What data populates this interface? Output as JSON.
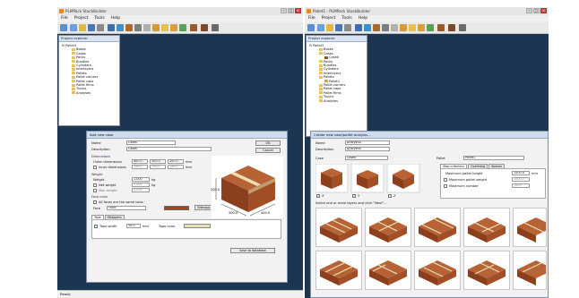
{
  "left_window": {
    "title": "PLMPack StackBuilder",
    "controls": [
      "–",
      "□",
      "×"
    ],
    "menu": [
      "File",
      "Project",
      "Tools",
      "Help"
    ],
    "explorer": {
      "title": "Project explorer",
      "root": "Pallet1",
      "items": [
        "Boxes",
        "Cases",
        "Packs",
        "Bundles",
        "Cylinders",
        "Interlayers",
        "Pallets",
        "Pallet corners",
        "Pallet caps",
        "Pallet films",
        "Trucks",
        "Analyses"
      ]
    },
    "dialog": {
      "title": "Add new case",
      "name_label": "Name",
      "name_value": "Case0",
      "desc_label": "Description",
      "desc_value": "Case0",
      "ok_label": "OK",
      "cancel_label": "Cancel",
      "dimensions_label": "Dimensions",
      "outer_label": "Outer dimensions",
      "outer_values": [
        "400.0",
        "300.0",
        "200.0"
      ],
      "inner_label": "Inner dimensions",
      "inner_values": [
        "396.0",
        "296.0",
        "196.0"
      ],
      "unit_mm": "mm",
      "weight_section": "Weight",
      "weight_label": "Weight",
      "weight_value": "1.000",
      "unit_kg": "kg",
      "net_weight_label": "Net weight",
      "net_weight_value": "0.000",
      "max_weight_label": "Max weight",
      "max_weight_value": "0.000",
      "face_color_section": "Face color",
      "all_faces_label": "All faces are the same color",
      "face_label": "Face",
      "face_value": "Front",
      "bitmaps_label": "Bitmaps...",
      "tabs": [
        "Tape",
        "Strappers"
      ],
      "tape_label": "Tape width",
      "tape_value": "50.0",
      "tape_unit": "mm",
      "tape_color_label": "Tape color",
      "save_label": "Save to database",
      "dim_length": "400.0",
      "dim_width": "300.0",
      "dim_height": "200.0"
    },
    "status": "Ready"
  },
  "right_window": {
    "title": "Pallet1 - PLMPack StackBuilder",
    "controls": [
      "–",
      "□",
      "×"
    ],
    "menu": [
      "File",
      "Project",
      "Tools",
      "Help"
    ],
    "explorer": {
      "title": "Project explorer",
      "root": "Pallet1",
      "items": [
        "Boxes",
        "Cases",
        "Case0",
        "Packs",
        "Bundles",
        "Cylinders",
        "Interlayers",
        "Pallets",
        "Pallet1",
        "Pallet corners",
        "Pallet caps",
        "Pallet films",
        "Trucks",
        "Analyses"
      ]
    },
    "dialog": {
      "title": "Create new case/pallet analysis...",
      "name_label": "Name",
      "name_value": "Analysis0",
      "desc_label": "Description",
      "desc_value": "Analysis0",
      "case_label": "Case",
      "case_value": "Case0",
      "pallet_label": "Pallet",
      "pallet_value": "Pallet1",
      "tabs": [
        "Stop criterions",
        "Overhang",
        "Spaces"
      ],
      "max_height_label": "Maximum pallet height",
      "max_height_value": "1500.0",
      "unit_mm": "mm",
      "max_weight_label": "Maximum pallet weight",
      "max_weight_value": "1000.0",
      "max_number_label": "Maximum number",
      "max_number_value": "1000",
      "orient_labels": [
        "X",
        "Y",
        "Z"
      ],
      "select_label": "Select one or more layers and click \"Next\"..."
    }
  },
  "colors": {
    "mdi": "#1c3553",
    "brick": "#9c4a24",
    "tape": "#e9e0b6"
  }
}
